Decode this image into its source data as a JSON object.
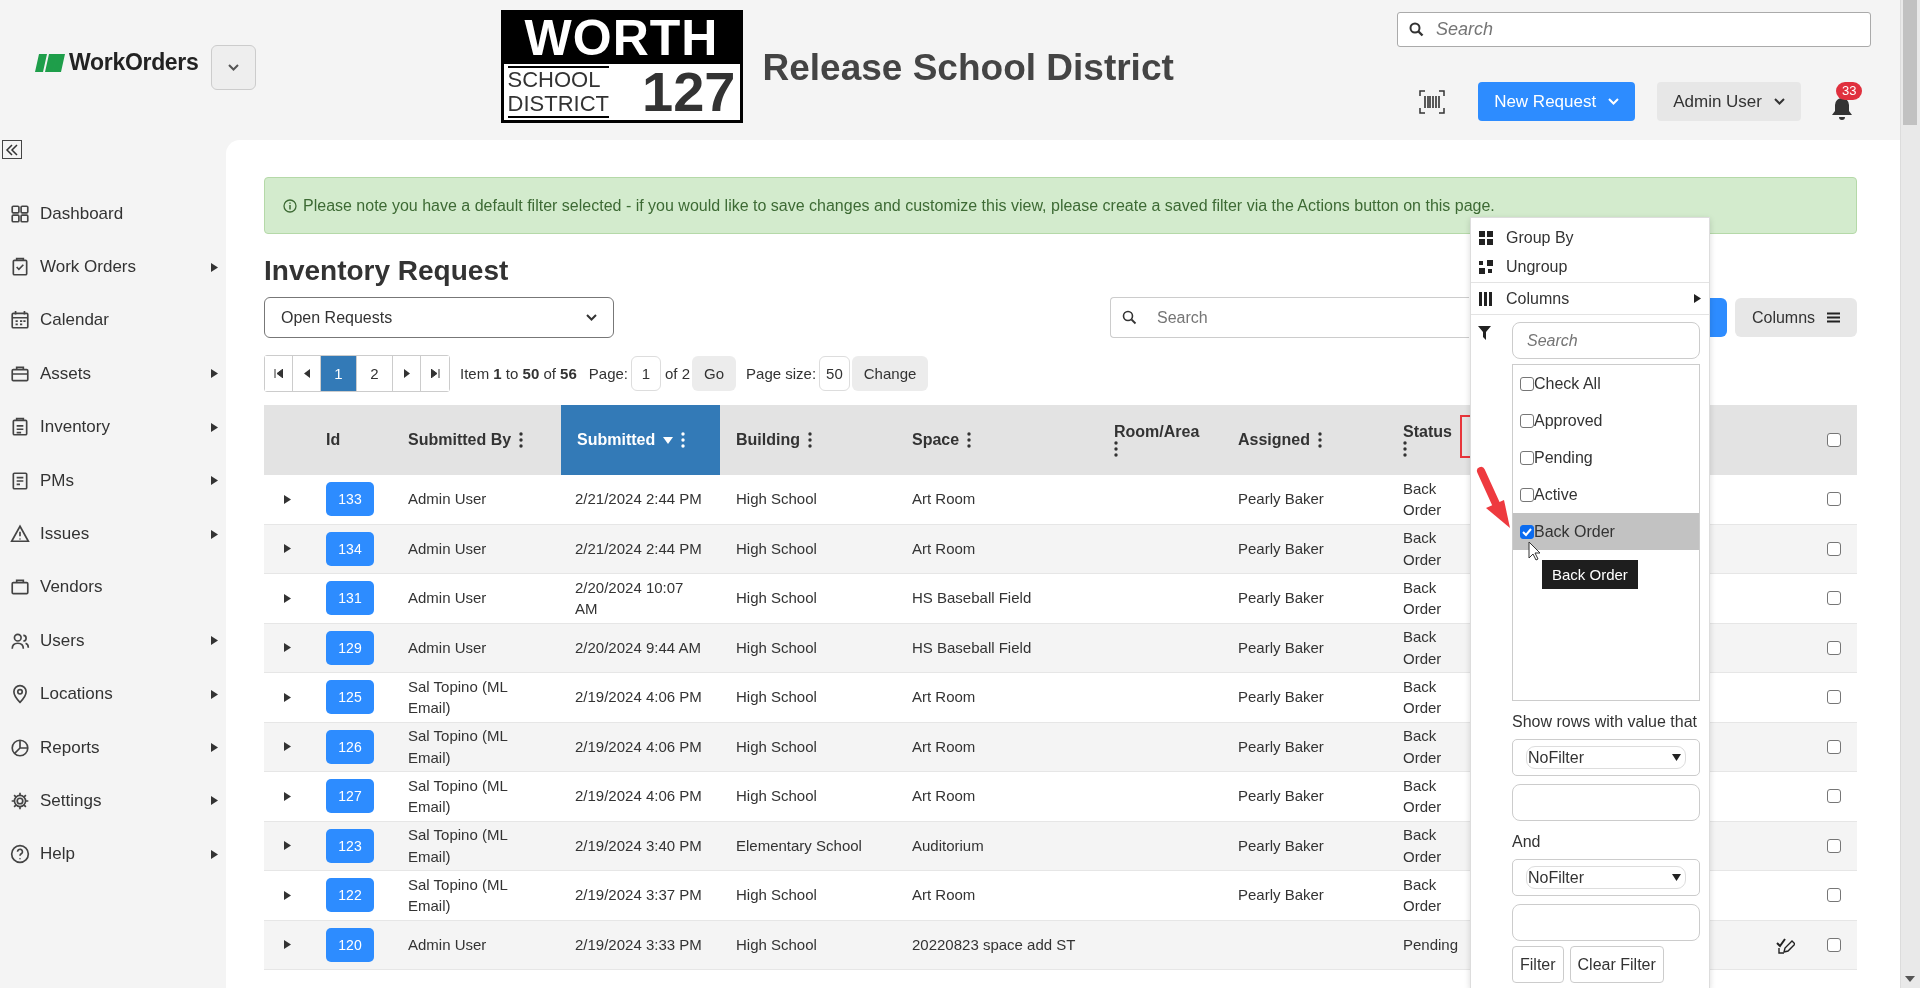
{
  "header": {
    "app_name": "WorkOrders",
    "district_logo": {
      "line_1": "WORTH",
      "line_2": "SCHOOL",
      "line_3": "DISTRICT",
      "number": "127"
    },
    "district_name": "Release School District",
    "search": {
      "placeholder": "Search"
    },
    "new_request": "New Request",
    "user": "Admin User",
    "notification_count": "33"
  },
  "sidebar": {
    "items": [
      {
        "label": "Dashboard",
        "has_submenu": false
      },
      {
        "label": "Work Orders",
        "has_submenu": true
      },
      {
        "label": "Calendar",
        "has_submenu": false
      },
      {
        "label": "Assets",
        "has_submenu": true
      },
      {
        "label": "Inventory",
        "has_submenu": true
      },
      {
        "label": "PMs",
        "has_submenu": true
      },
      {
        "label": "Issues",
        "has_submenu": true
      },
      {
        "label": "Vendors",
        "has_submenu": false
      },
      {
        "label": "Users",
        "has_submenu": true
      },
      {
        "label": "Locations",
        "has_submenu": true
      },
      {
        "label": "Reports",
        "has_submenu": true
      },
      {
        "label": "Settings",
        "has_submenu": true
      },
      {
        "label": "Help",
        "has_submenu": true
      }
    ]
  },
  "notice": "Please note you have a default filter selected - if you would like to save changes and customize this view, please create a saved filter via the Actions button on this page.",
  "page_title": "Inventory Request",
  "view_select": {
    "value": "Open Requests"
  },
  "search": {
    "placeholder": "Search"
  },
  "columns_button": "Columns",
  "pager": {
    "pages": [
      {
        "label": "1",
        "selected": true
      },
      {
        "label": "2",
        "selected": false
      }
    ],
    "summary": "Item **1** to **50** of **56**",
    "page_label": "Page:",
    "page_value": "1",
    "page_of": "of 2",
    "go": "Go",
    "page_size_label": "Page size:",
    "page_size": "50",
    "change": "Change"
  },
  "table": {
    "columns": [
      {
        "label": "Id",
        "menu": false,
        "selected": false
      },
      {
        "label": "Submitted By",
        "menu": true,
        "selected": false
      },
      {
        "label": "Submitted",
        "menu": true,
        "selected": true,
        "sorted": true
      },
      {
        "label": "Building",
        "menu": true,
        "selected": false
      },
      {
        "label": "Space",
        "menu": true,
        "selected": false
      },
      {
        "label": "Room/Area",
        "menu": true,
        "selected": false
      },
      {
        "label": "Assigned",
        "menu": true,
        "selected": false
      },
      {
        "label": "Status",
        "menu": true,
        "selected": false,
        "annotated": true
      }
    ],
    "rows": [
      {
        "id": "133",
        "submitted_by": "Admin User",
        "submitted": "2/21/2024 2:44 PM",
        "building": "High School",
        "space": "Art Room",
        "assigned": "Pearly Baker",
        "status": "Back Order",
        "has_action": false,
        "checked": false
      },
      {
        "id": "134",
        "submitted_by": "Admin User",
        "submitted": "2/21/2024 2:44 PM",
        "building": "High School",
        "space": "Art Room",
        "assigned": "Pearly Baker",
        "status": "Back Order",
        "has_action": false,
        "checked": false
      },
      {
        "id": "131",
        "submitted_by": "Admin User",
        "submitted": "2/20/2024 10:07 AM",
        "building": "High School",
        "space": "HS Baseball Field",
        "assigned": "Pearly Baker",
        "status": "Back Order",
        "has_action": false,
        "checked": false
      },
      {
        "id": "129",
        "submitted_by": "Admin User",
        "submitted": "2/20/2024 9:44 AM",
        "building": "High School",
        "space": "HS Baseball Field",
        "assigned": "Pearly Baker",
        "status": "Back Order",
        "has_action": false,
        "checked": false
      },
      {
        "id": "125",
        "submitted_by": "Sal Topino (ML Email)",
        "submitted": "2/19/2024 4:06 PM",
        "building": "High School",
        "space": "Art Room",
        "assigned": "Pearly Baker",
        "status": "Back Order",
        "has_action": false,
        "checked": false
      },
      {
        "id": "126",
        "submitted_by": "Sal Topino (ML Email)",
        "submitted": "2/19/2024 4:06 PM",
        "building": "High School",
        "space": "Art Room",
        "assigned": "Pearly Baker",
        "status": "Back Order",
        "has_action": false,
        "checked": false
      },
      {
        "id": "127",
        "submitted_by": "Sal Topino (ML Email)",
        "submitted": "2/19/2024 4:06 PM",
        "building": "High School",
        "space": "Art Room",
        "assigned": "Pearly Baker",
        "status": "Back Order",
        "has_action": false,
        "checked": false
      },
      {
        "id": "123",
        "submitted_by": "Sal Topino (ML Email)",
        "submitted": "2/19/2024 3:40 PM",
        "building": "Elementary School",
        "space": "Auditorium",
        "assigned": "Pearly Baker",
        "status": "Back Order",
        "has_action": false,
        "checked": false
      },
      {
        "id": "122",
        "submitted_by": "Sal Topino (ML Email)",
        "submitted": "2/19/2024 3:37 PM",
        "building": "High School",
        "space": "Art Room",
        "assigned": "Pearly Baker",
        "status": "Back Order",
        "has_action": false,
        "checked": false
      },
      {
        "id": "120",
        "submitted_by": "Admin User",
        "submitted": "2/19/2024 3:33 PM",
        "building": "High School",
        "space": "20220823 space add ST",
        "status": "Pending",
        "has_action": true,
        "checked": false
      }
    ],
    "all_checked": false
  },
  "filter_menu": {
    "menu_items": [
      {
        "label": "Group By",
        "has_submenu": false
      },
      {
        "label": "Ungroup",
        "has_submenu": false
      },
      {
        "label": "Columns",
        "has_submenu": true
      }
    ],
    "search": {
      "placeholder": "Search"
    },
    "options": [
      {
        "label": "Check All",
        "checked": false,
        "hovered": false
      },
      {
        "label": "Approved",
        "checked": false,
        "hovered": false
      },
      {
        "label": "Pending",
        "checked": false,
        "hovered": false
      },
      {
        "label": "Active",
        "checked": false,
        "hovered": false
      },
      {
        "label": "Back Order",
        "checked": true,
        "hovered": true
      }
    ],
    "tooltip": "Back Order",
    "condition_label": "Show rows with value that",
    "conditions": [
      {
        "operator": "NoFilter"
      },
      {
        "operator": "NoFilter"
      }
    ],
    "and_label": "And",
    "buttons": [
      "Filter",
      "Clear Filter"
    ]
  }
}
